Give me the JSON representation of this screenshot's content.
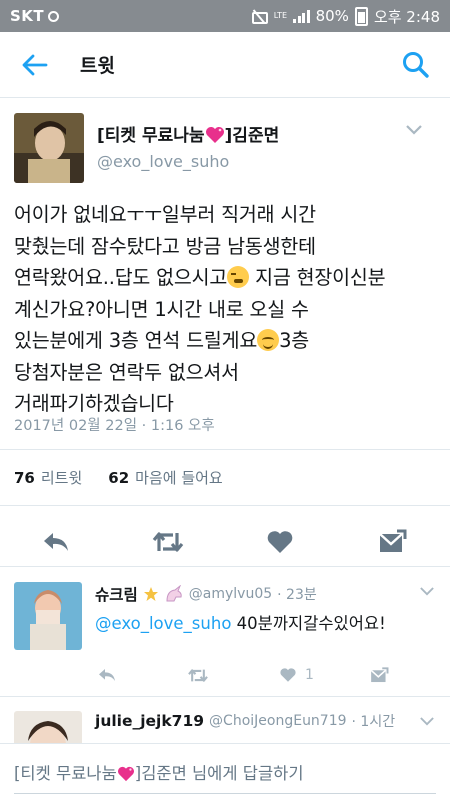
{
  "status_bar": {
    "carrier": "SKT",
    "network": "LTE",
    "battery": "80%",
    "time": "오후 2:48"
  },
  "app_bar": {
    "title": "트윗",
    "back_icon": "arrow-left-icon",
    "search_icon": "search-icon"
  },
  "tweet": {
    "author_name": "[티켓 무료나눔",
    "author_name_tail": "]김준면",
    "author_handle": "@exo_love_suho",
    "body_lines": [
      "어이가 없네요ㅜㅜ일부러 직거래 시간",
      "맞췄는데 잠수탔다고 방금 남동생한테",
      "연락왔어요..답도 없으시고",
      " 지금 현장이신분",
      "계신가요?아니면 1시간 내로 오실 수",
      "있는분에게 3층 연석 드릴게요",
      "3층",
      "당첨자분은 연락두 없으셔서",
      "거래파기하겠습니다"
    ],
    "timestamp": "2017년 02월 22일 · 1:16 오후",
    "retweets_count": "76",
    "retweets_label": "리트윗",
    "likes_count": "62",
    "likes_label": "마음에 들어요"
  },
  "replies": [
    {
      "name": "슈크림",
      "handle": "@amylvu05",
      "time": "· 23분",
      "mention": "@exo_love_suho",
      "text": " 40분까지갈수있어요!",
      "like_count": "1"
    },
    {
      "name": "julie_jejk719",
      "handle": "@ChoiJeongEun719",
      "time": "· 1시간"
    }
  ],
  "reply_bar": {
    "placeholder_head": "[티켓 무료나눔",
    "placeholder_tail": "]김준면 님에게 답글하기"
  },
  "colors": {
    "accent": "#1da1f2",
    "secondary_text": "#8899a6",
    "status_bar": "#868b90",
    "heart_emoji": "#e8308c"
  }
}
